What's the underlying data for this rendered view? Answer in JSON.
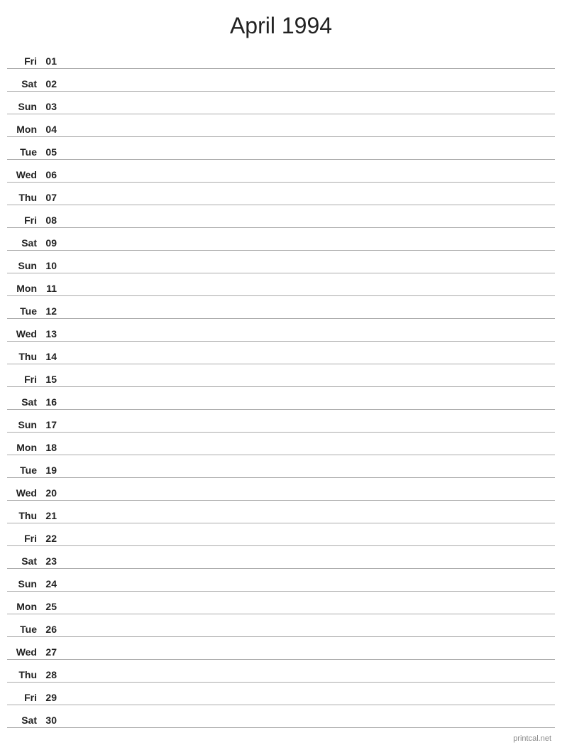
{
  "title": "April 1994",
  "footer": "printcal.net",
  "days": [
    {
      "name": "Fri",
      "num": "01"
    },
    {
      "name": "Sat",
      "num": "02"
    },
    {
      "name": "Sun",
      "num": "03"
    },
    {
      "name": "Mon",
      "num": "04"
    },
    {
      "name": "Tue",
      "num": "05"
    },
    {
      "name": "Wed",
      "num": "06"
    },
    {
      "name": "Thu",
      "num": "07"
    },
    {
      "name": "Fri",
      "num": "08"
    },
    {
      "name": "Sat",
      "num": "09"
    },
    {
      "name": "Sun",
      "num": "10"
    },
    {
      "name": "Mon",
      "num": "11"
    },
    {
      "name": "Tue",
      "num": "12"
    },
    {
      "name": "Wed",
      "num": "13"
    },
    {
      "name": "Thu",
      "num": "14"
    },
    {
      "name": "Fri",
      "num": "15"
    },
    {
      "name": "Sat",
      "num": "16"
    },
    {
      "name": "Sun",
      "num": "17"
    },
    {
      "name": "Mon",
      "num": "18"
    },
    {
      "name": "Tue",
      "num": "19"
    },
    {
      "name": "Wed",
      "num": "20"
    },
    {
      "name": "Thu",
      "num": "21"
    },
    {
      "name": "Fri",
      "num": "22"
    },
    {
      "name": "Sat",
      "num": "23"
    },
    {
      "name": "Sun",
      "num": "24"
    },
    {
      "name": "Mon",
      "num": "25"
    },
    {
      "name": "Tue",
      "num": "26"
    },
    {
      "name": "Wed",
      "num": "27"
    },
    {
      "name": "Thu",
      "num": "28"
    },
    {
      "name": "Fri",
      "num": "29"
    },
    {
      "name": "Sat",
      "num": "30"
    }
  ]
}
